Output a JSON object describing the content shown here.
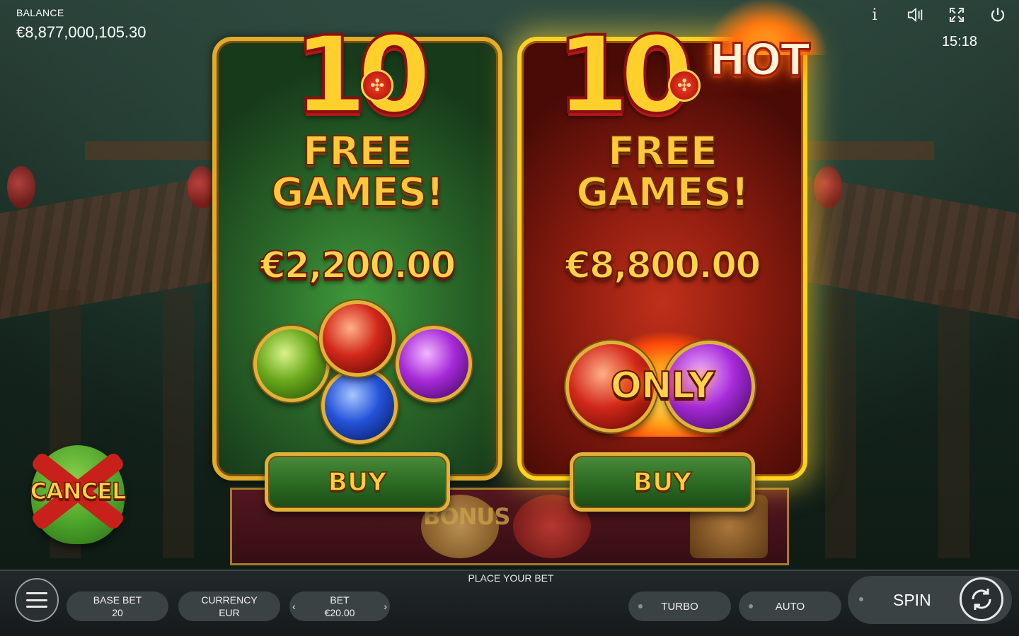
{
  "balance": {
    "label": "BALANCE",
    "value": "€8,877,000,105.30"
  },
  "clock": "15:18",
  "top_icons": [
    "info-icon",
    "sound-icon",
    "fullscreen-icon",
    "power-icon"
  ],
  "info_glyph": "i",
  "offers": [
    {
      "amount": "10",
      "title_line1": "FREE",
      "title_line2": "GAMES!",
      "price": "€2,200.00",
      "buy_label": "BUY"
    },
    {
      "amount": "10",
      "badge": "HOT",
      "title_line1": "FREE",
      "title_line2": "GAMES!",
      "price": "€8,800.00",
      "only_label": "ONLY",
      "buy_label": "BUY"
    }
  ],
  "reel_label": "BONUS",
  "cancel_label": "CANCEL",
  "bottom": {
    "place_bet": "PLACE YOUR BET",
    "base_bet_label": "BASE BET",
    "base_bet_value": "20",
    "currency_label": "CURRENCY",
    "currency_value": "EUR",
    "bet_label": "BET",
    "bet_value": "€20.00",
    "turbo_label": "TURBO",
    "auto_label": "AUTO",
    "spin_label": "SPIN"
  },
  "colors": {
    "gold": "#e0ac2a",
    "hot_border": "#ffd21e",
    "green_card": "#2b6a2a",
    "red_card": "#8f1d10"
  }
}
